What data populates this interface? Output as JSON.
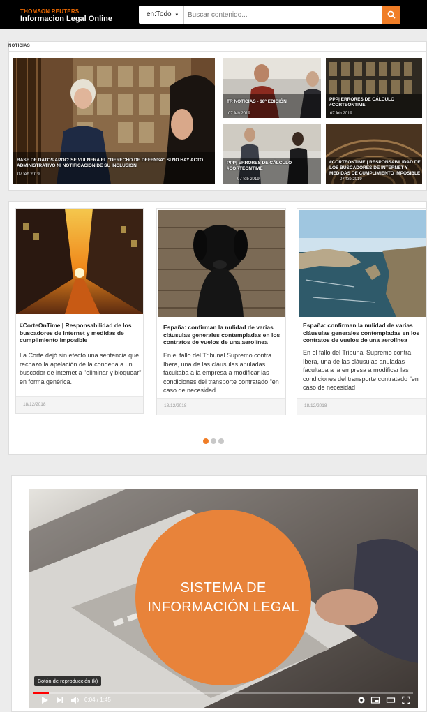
{
  "header": {
    "brand_top": "THOMSON REUTERS",
    "brand_name": "Informacion Legal Online",
    "scope_label": "en:Todo",
    "search_placeholder": "Buscar contenido...",
    "accent_color": "#f07d26"
  },
  "news": {
    "section_title": "NOTICIAS",
    "tiles": [
      {
        "caption": "BASE DE DATOS APOC: SE VULNERA EL \"DERECHO DE DEFENSA\" SI NO HAY ACTO ADMINISTRATIVO NI NOTIFICACIÓN DE SU INCLUSIÓN",
        "date": "07 feb 2019"
      },
      {
        "caption": "TR NOTICIAS - 18º EDICIÓN",
        "date": "07 feb 2019"
      },
      {
        "caption": "PPP| ERRORES DE CÁLCULO #CORTEONTIME",
        "date": "07 feb 2019"
      },
      {
        "caption": "PPP| ERRORES DE CÁLCULO #CORTEONTIME",
        "date": "07 feb 2019"
      },
      {
        "caption": "#CORTEONTIME | RESPONSABILIDAD DE LOS BUSCADORES DE INTERNET Y MEDIDAS DE CUMPLIMIENTO IMPOSIBLE",
        "date": "07 feb 2019"
      }
    ]
  },
  "carousel": {
    "cards": [
      {
        "title": "#CorteOnTime | Responsabilidad de los buscadores de internet y medidas de cumplimiento imposible",
        "body": "La Corte dejó sin efecto una sentencia que rechazó la apelación de la condena a un buscador de internet a \"eliminar y bloquear\" en forma genérica.",
        "date": "18/12/2018"
      },
      {
        "title": "España: confirman la nulidad de varias cláusulas generales contempladas en los contratos de vuelos de una aerolínea",
        "body": "En el fallo del Tribunal Supremo contra Ibera, una de las cláusulas anuladas facultaba a la empresa a modificar las condiciones del transporte contratado \"en caso de necesidad",
        "date": "18/12/2018"
      },
      {
        "title": "España: confirman la nulidad de varias cláusulas generales contempladas en los contratos de vuelos de una aerolínea",
        "body": "En el fallo del Tribunal Supremo contra Ibera, una de las cláusulas anuladas facultaba a la empresa a modificar las condiciones del transporte contratado \"en caso de necesidad",
        "date": "18/12/2018"
      }
    ],
    "active_dot": 0,
    "dot_count": 3
  },
  "video": {
    "overlay_title_line1": "SISTEMA DE",
    "overlay_title_line2": "INFORMACIÓN LEGAL",
    "tooltip": "Botón de reproducción (k)",
    "time": "0:04 / 1:45",
    "progress_fraction": 0.04
  }
}
